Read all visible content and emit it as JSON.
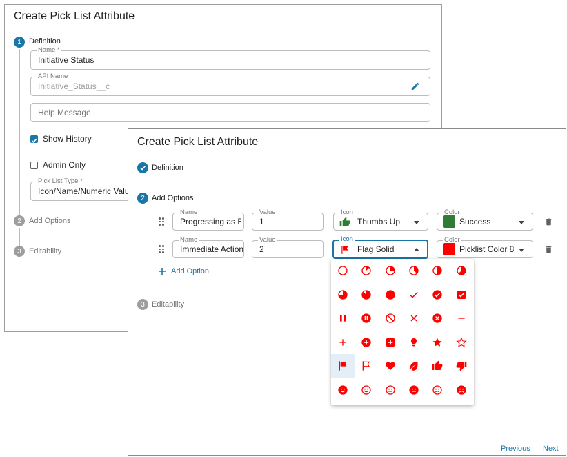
{
  "background_dialog": {
    "title": "Create Pick List Attribute",
    "steps": [
      {
        "number": "1",
        "label": "Definition"
      },
      {
        "number": "2",
        "label": "Add Options"
      },
      {
        "number": "3",
        "label": "Editability"
      }
    ],
    "name_field": {
      "label": "Name *",
      "value": "Initiative Status"
    },
    "api_name_field": {
      "label": "API Name",
      "value": "Initiative_Status__c"
    },
    "help_field": {
      "placeholder": "Help Message"
    },
    "show_history": {
      "label": "Show History",
      "checked": true
    },
    "admin_only": {
      "label": "Admin Only",
      "checked": false
    },
    "pick_list_type": {
      "label": "Pick List Type *",
      "value": "Icon/Name/Numeric Value"
    }
  },
  "foreground_dialog": {
    "title": "Create Pick List Attribute",
    "steps": [
      {
        "number": "",
        "label": "Definition"
      },
      {
        "number": "2",
        "label": "Add Options"
      },
      {
        "number": "3",
        "label": "Editability"
      }
    ],
    "field_labels": {
      "name": "Name",
      "value": "Value",
      "icon": "Icon",
      "color": "Color"
    },
    "options": [
      {
        "name": "Progressing as Exp",
        "value": "1",
        "icon": "Thumbs Up",
        "icon_color": "#2e7d32",
        "color": "Success",
        "color_hex": "#2e7d32"
      },
      {
        "name": "Immediate Action",
        "value": "2",
        "icon": "Flag Solid",
        "icon_color": "#ff0000",
        "color": "Picklist Color 8",
        "color_hex": "#ff0000"
      }
    ],
    "add_option_label": "Add Option",
    "footer": {
      "previous": "Previous",
      "next": "Next"
    }
  },
  "icon_menu": {
    "icon_color": "#ff0000",
    "selected": "flag-solid",
    "rows": [
      [
        "circle-empty-icon",
        "circle-eighth-icon",
        "circle-quarter-icon",
        "circle-three-eighths-icon",
        "circle-half-icon",
        "circle-five-eighths-icon"
      ],
      [
        "circle-three-quarters-icon",
        "circle-seven-eighths-icon",
        "circle-full-icon",
        "check-icon",
        "check-circle-icon",
        "check-square-icon"
      ],
      [
        "pause-icon",
        "pause-circle-icon",
        "ban-icon",
        "times-icon",
        "times-circle-icon",
        "minus-icon"
      ],
      [
        "plus-icon",
        "plus-circle-icon",
        "plus-square-icon",
        "lightbulb-icon",
        "star-solid-icon",
        "star-outline-icon"
      ],
      [
        "flag-solid-icon",
        "flag-outline-icon",
        "heart-icon",
        "leaf-icon",
        "thumbs-up-icon",
        "thumbs-down-icon"
      ],
      [
        "smile-solid-icon",
        "smile-outline-icon",
        "meh-outline-icon",
        "meh-solid-icon",
        "frown-outline-icon",
        "frown-solid-icon"
      ]
    ]
  },
  "colors": {
    "accent": "#1976a8",
    "success": "#2e7d32",
    "picklist_8": "#ff0000"
  }
}
